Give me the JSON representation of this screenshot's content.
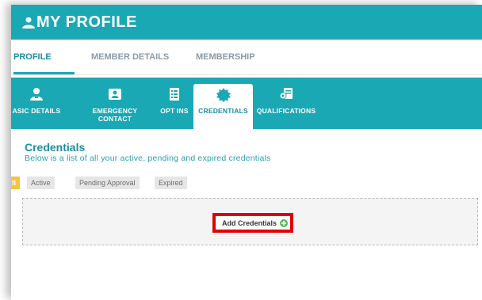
{
  "header": {
    "title": "MY PROFILE",
    "icon": "user-icon"
  },
  "main_tabs": [
    {
      "label": "PROFILE",
      "active": true
    },
    {
      "label": "MEMBER DETAILS",
      "active": false
    },
    {
      "label": "MEMBERSHIP",
      "active": false
    }
  ],
  "sub_tabs": [
    {
      "label": "ASIC DETAILS",
      "icon": "user-details-icon",
      "active": false
    },
    {
      "label": "EMERGENCY CONTACT",
      "label_line1": "EMERGENCY",
      "label_line2": "CONTACT",
      "icon": "contact-card-icon",
      "active": false
    },
    {
      "label": "OPT INS",
      "icon": "checklist-icon",
      "active": false
    },
    {
      "label": "CREDENTIALS",
      "icon": "badge-icon",
      "active": true
    },
    {
      "label": "QUALIFICATIONS",
      "icon": "certificate-icon",
      "active": false
    }
  ],
  "section": {
    "title": "Credentials",
    "description": "Below is a list of all your active, pending and expired credentials"
  },
  "filters": [
    {
      "label": "ll",
      "active": true
    },
    {
      "label": "Active",
      "active": false
    },
    {
      "label": "Pending Approval",
      "active": false
    },
    {
      "label": "Expired",
      "active": false
    }
  ],
  "actions": {
    "add_credentials_label": "Add Credentials",
    "add_icon": "plus-circle-icon"
  },
  "colors": {
    "accent": "#1aa8b4",
    "accent_dark": "#1a8fa0",
    "filter_active": "#f6c342",
    "highlight_border": "#e00000",
    "add_icon_green": "#5cb85c"
  }
}
